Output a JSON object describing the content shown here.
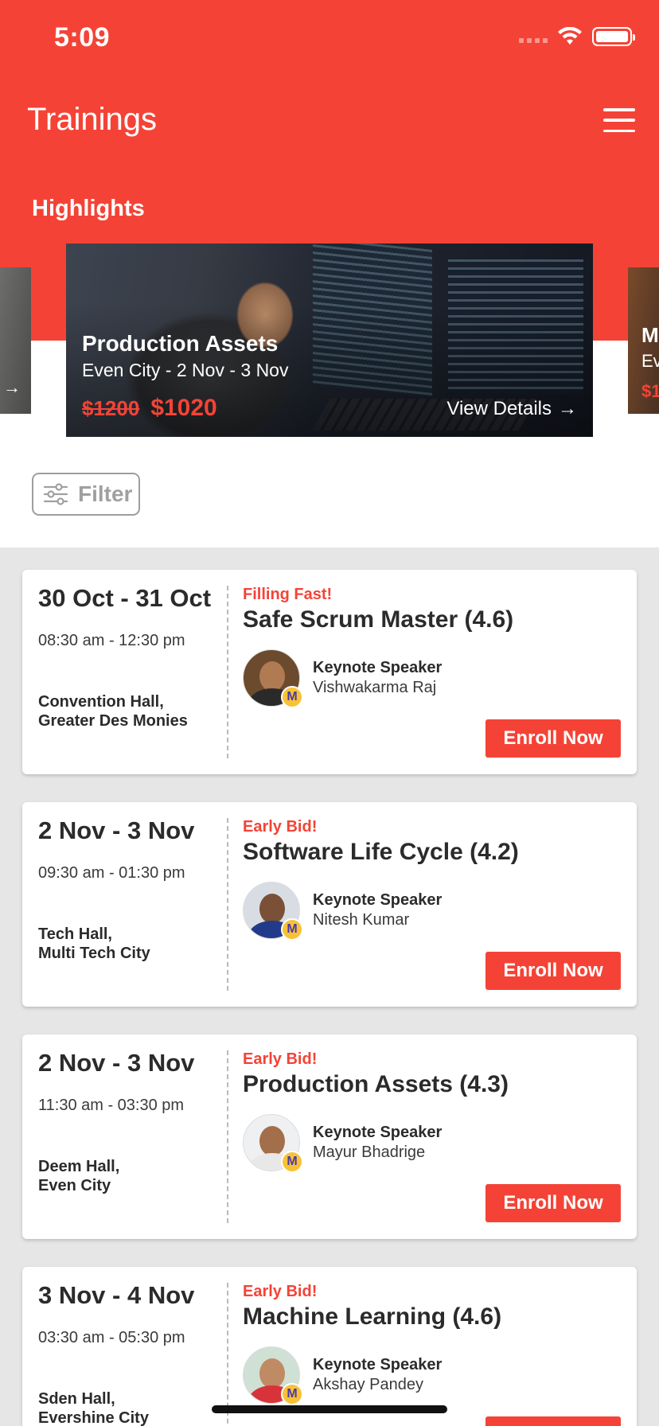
{
  "status_bar": {
    "time": "5:09"
  },
  "header": {
    "title": "Trainings"
  },
  "highlights": {
    "label": "Highlights",
    "main": {
      "title": "Production Assets",
      "subtitle": "Even City - 2 Nov - 3 Nov",
      "old_price": "$1200",
      "new_price": "$1020",
      "view_label": "View Details"
    },
    "right_peek": {
      "title": "M",
      "subtitle": "Ev",
      "price": "$1"
    }
  },
  "filter": {
    "label": "Filter"
  },
  "speaker_label": "Keynote Speaker",
  "enroll_label": "Enroll Now",
  "trainings": [
    {
      "date": "30 Oct - 31 Oct",
      "time": "08:30 am - 12:30 pm",
      "venue_line1": "Convention Hall,",
      "venue_line2": "Greater Des Monies",
      "tag": "Filling Fast!",
      "title": "Safe Scrum Master (4.6)",
      "speaker": "Vishwakarma Raj",
      "avatar_bg": "#6b4a2e",
      "skin": "#b07a52",
      "shirt": "#2a2a2a"
    },
    {
      "date": "2 Nov - 3 Nov",
      "time": "09:30 am - 01:30 pm",
      "venue_line1": "Tech Hall,",
      "venue_line2": "Multi Tech City",
      "tag": "Early Bid!",
      "title": "Software Life Cycle (4.2)",
      "speaker": "Nitesh Kumar",
      "avatar_bg": "#d8dde3",
      "skin": "#7a5037",
      "shirt": "#223a8a"
    },
    {
      "date": "2 Nov - 3 Nov",
      "time": "11:30 am - 03:30 pm",
      "venue_line1": "Deem Hall,",
      "venue_line2": "Even City",
      "tag": "Early Bid!",
      "title": "Production Assets (4.3)",
      "speaker": "Mayur Bhadrige",
      "avatar_bg": "#eef0f2",
      "skin": "#a36e4a",
      "shirt": "#e8e8e8"
    },
    {
      "date": "3 Nov - 4 Nov",
      "time": "03:30 am - 05:30 pm",
      "venue_line1": "Sden Hall,",
      "venue_line2": "Evershine City",
      "tag": "Early Bid!",
      "title": "Machine Learning (4.6)",
      "speaker": "Akshay Pandey",
      "avatar_bg": "#cfe0d4",
      "skin": "#c08a64",
      "shirt": "#d8333a"
    }
  ],
  "colors": {
    "accent": "#f44336",
    "badge": "#f8c235"
  }
}
